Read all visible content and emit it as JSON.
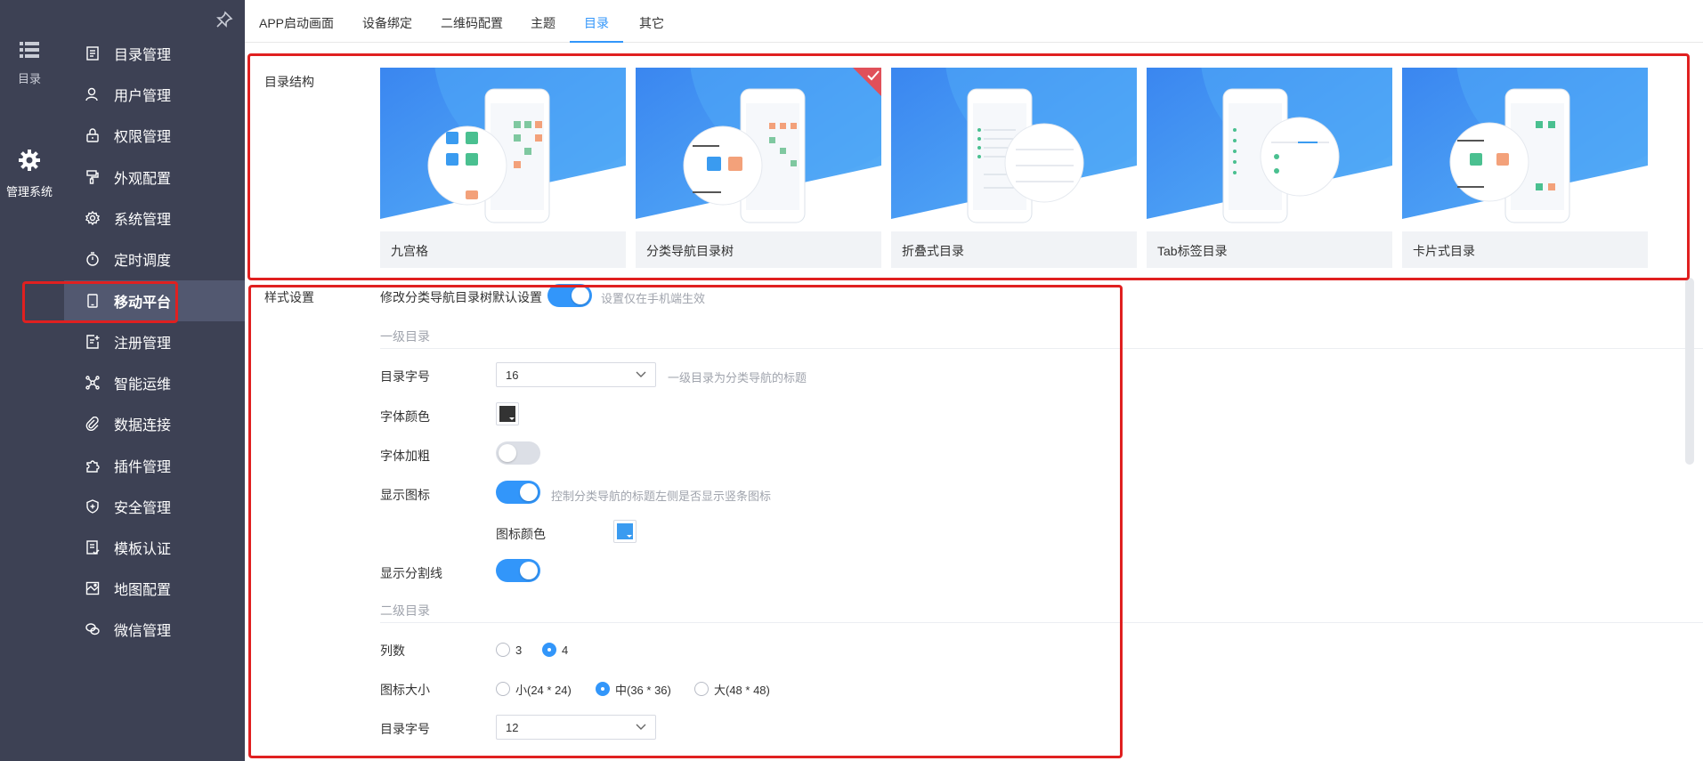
{
  "rail": {
    "items": [
      {
        "label": "目录",
        "icon": "list-icon"
      },
      {
        "label": "管理系统",
        "icon": "gear-icon"
      }
    ]
  },
  "sidebar": {
    "items": [
      {
        "label": "目录管理",
        "icon": "catalog-icon"
      },
      {
        "label": "用户管理",
        "icon": "user-icon"
      },
      {
        "label": "权限管理",
        "icon": "lock-icon"
      },
      {
        "label": "外观配置",
        "icon": "brush-icon"
      },
      {
        "label": "系统管理",
        "icon": "settings-icon"
      },
      {
        "label": "定时调度",
        "icon": "timer-icon"
      },
      {
        "label": "移动平台",
        "icon": "mobile-icon",
        "active": true
      },
      {
        "label": "注册管理",
        "icon": "register-icon"
      },
      {
        "label": "智能运维",
        "icon": "network-icon"
      },
      {
        "label": "数据连接",
        "icon": "link-icon"
      },
      {
        "label": "插件管理",
        "icon": "plugin-icon"
      },
      {
        "label": "安全管理",
        "icon": "shield-icon"
      },
      {
        "label": "模板认证",
        "icon": "template-icon"
      },
      {
        "label": "地图配置",
        "icon": "map-icon"
      },
      {
        "label": "微信管理",
        "icon": "wechat-icon"
      }
    ]
  },
  "tabs": [
    "APP启动画面",
    "设备绑定",
    "二维码配置",
    "主题",
    "目录",
    "其它"
  ],
  "active_tab": "目录",
  "catalog_structure": {
    "label": "目录结构",
    "cards": [
      {
        "name": "九宫格",
        "selected": false
      },
      {
        "name": "分类导航目录树",
        "selected": true
      },
      {
        "name": "折叠式目录",
        "selected": false
      },
      {
        "name": "Tab标签目录",
        "selected": false
      },
      {
        "name": "卡片式目录",
        "selected": false
      }
    ]
  },
  "style_settings": {
    "label": "样式设置",
    "modify_default": {
      "label": "修改分类导航目录树默认设置",
      "on": true,
      "hint": "设置仅在手机端生效"
    },
    "level1": {
      "title": "一级目录",
      "font_size": {
        "label": "目录字号",
        "value": "16",
        "hint": "一级目录为分类导航的标题"
      },
      "font_color": {
        "label": "字体颜色",
        "color": "#333333"
      },
      "bold": {
        "label": "字体加粗",
        "on": false
      },
      "show_icon": {
        "label": "显示图标",
        "on": true,
        "hint": "控制分类导航的标题左侧是否显示竖条图标"
      },
      "icon_color": {
        "label": "图标颜色",
        "color": "#3a9bf0"
      },
      "show_divider": {
        "label": "显示分割线",
        "on": true
      }
    },
    "level2": {
      "title": "二级目录",
      "columns": {
        "label": "列数",
        "options": [
          "3",
          "4"
        ],
        "selected": "4"
      },
      "icon_size": {
        "label": "图标大小",
        "options": [
          "小(24 * 24)",
          "中(36 * 36)",
          "大(48 * 48)"
        ],
        "selected": "中(36 * 36)"
      },
      "font_size": {
        "label": "目录字号",
        "value": "12"
      }
    }
  },
  "colors": {
    "sidebar_bg": "#3d4154",
    "active_item": "#525870",
    "accent": "#3296fa",
    "annotation": "#e02020"
  }
}
